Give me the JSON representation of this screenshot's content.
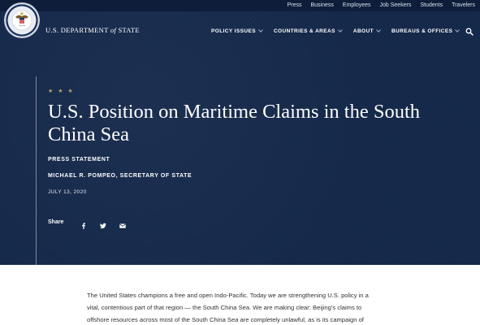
{
  "utility_nav": [
    "Press",
    "Business",
    "Employees",
    "Job Seekers",
    "Students",
    "Travelers"
  ],
  "header": {
    "dept_prefix": "U.S. DEPARTMENT",
    "dept_of": "of",
    "dept_suffix": "STATE"
  },
  "main_nav": [
    {
      "label": "POLICY ISSUES"
    },
    {
      "label": "COUNTRIES & AREAS"
    },
    {
      "label": "ABOUT"
    },
    {
      "label": "BUREAUS & OFFICES"
    }
  ],
  "article": {
    "stars": "★ ★ ★",
    "title": "U.S. Position on Maritime Claims in the South China Sea",
    "kind": "PRESS STATEMENT",
    "author": "MICHAEL R. POMPEO, SECRETARY OF STATE",
    "date": "JULY 13, 2020",
    "share_label": "Share",
    "body_lines": [
      "The United States champions a free and open Indo-Pacific. Today we are strengthening U.S. policy in a",
      "vital, contentious part of that region — the South China Sea. We are making clear: Beijing’s claims to",
      "offshore resources across most of the South China Sea are completely unlawful, as is its campaign of"
    ]
  },
  "icons": {
    "seal": "department-seal-icon",
    "search": "search-icon",
    "facebook": "facebook-icon",
    "twitter": "twitter-icon",
    "email": "email-icon",
    "chevron": "chevron-down-icon"
  },
  "colors": {
    "hero_bg": "#14284a",
    "topbar_bg": "#0e1e3a",
    "stars": "#b8a06a",
    "text_light": "#ffffff",
    "body_text": "#333333"
  }
}
